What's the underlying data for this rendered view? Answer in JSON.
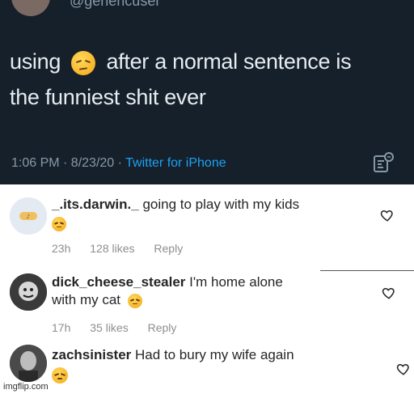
{
  "tweet": {
    "handle": "@genericuser",
    "text_part1": "using",
    "text_part2": "after a normal sentence is",
    "text_part3": "the funniest shit ever",
    "time": "1:06 PM · 8/23/20 · ",
    "source": "Twitter for iPhone",
    "emoji_name": "relieved-face-emoji",
    "background_color": "#15202b"
  },
  "comments": [
    {
      "username": "_.its.darwin._",
      "text": "going to play with my kids",
      "age": "23h",
      "likes": "128 likes",
      "reply": "Reply"
    },
    {
      "username": "dick_cheese_stealer",
      "text": "I'm home alone",
      "text_line2": "with my cat",
      "age": "17h",
      "likes": "35 likes",
      "reply": "Reply"
    },
    {
      "username": "zachsinister",
      "text": "Had to bury my wife again"
    }
  ],
  "watermark": "imgflip.com"
}
